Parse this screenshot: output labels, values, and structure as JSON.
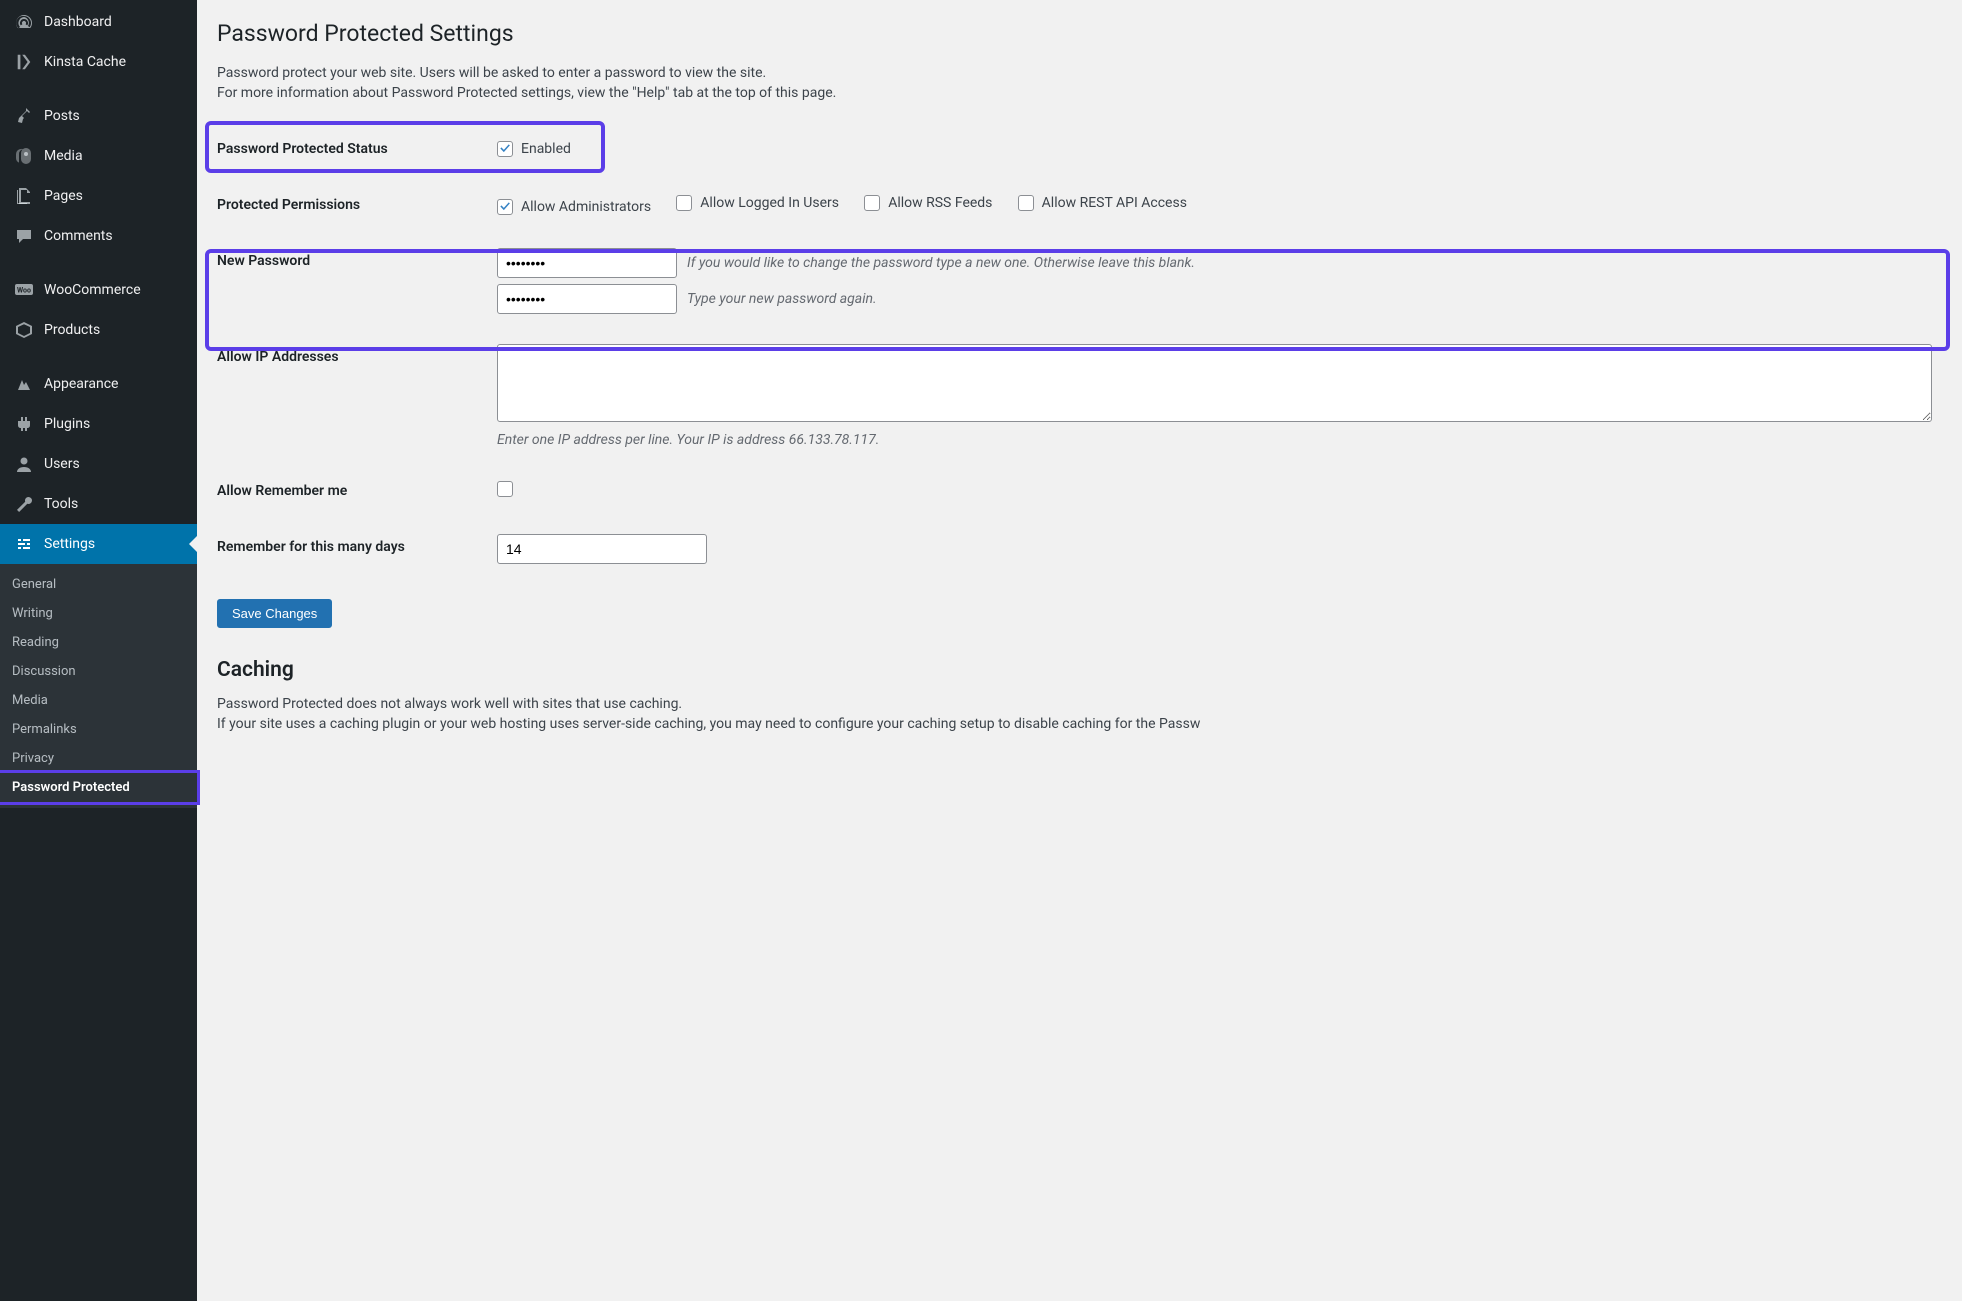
{
  "sidebar": {
    "items": [
      {
        "label": "Dashboard",
        "icon": "dashboard"
      },
      {
        "label": "Kinsta Cache",
        "icon": "kinsta"
      },
      {
        "label": "Posts",
        "icon": "pin"
      },
      {
        "label": "Media",
        "icon": "media"
      },
      {
        "label": "Pages",
        "icon": "pages"
      },
      {
        "label": "Comments",
        "icon": "comments"
      },
      {
        "label": "WooCommerce",
        "icon": "woo"
      },
      {
        "label": "Products",
        "icon": "products"
      },
      {
        "label": "Appearance",
        "icon": "appearance"
      },
      {
        "label": "Plugins",
        "icon": "plugins"
      },
      {
        "label": "Users",
        "icon": "users"
      },
      {
        "label": "Tools",
        "icon": "tools"
      },
      {
        "label": "Settings",
        "icon": "settings"
      }
    ],
    "submenu": [
      {
        "label": "General"
      },
      {
        "label": "Writing"
      },
      {
        "label": "Reading"
      },
      {
        "label": "Discussion"
      },
      {
        "label": "Media"
      },
      {
        "label": "Permalinks"
      },
      {
        "label": "Privacy"
      },
      {
        "label": "Password Protected"
      }
    ]
  },
  "page": {
    "title": "Password Protected Settings",
    "desc1": "Password protect your web site. Users will be asked to enter a password to view the site.",
    "desc2": "For more information about Password Protected settings, view the \"Help\" tab at the top of this page."
  },
  "form": {
    "status": {
      "label": "Password Protected Status",
      "enabled_label": "Enabled",
      "checked": true
    },
    "permissions": {
      "label": "Protected Permissions",
      "options": [
        {
          "label": "Allow Administrators",
          "checked": true
        },
        {
          "label": "Allow Logged In Users",
          "checked": false
        },
        {
          "label": "Allow RSS Feeds",
          "checked": false
        },
        {
          "label": "Allow REST API Access",
          "checked": false
        }
      ]
    },
    "new_password": {
      "label": "New Password",
      "value1": "••••••••",
      "value2": "••••••••",
      "hint1": "If you would like to change the password type a new one. Otherwise leave this blank.",
      "hint2": "Type your new password again."
    },
    "allow_ip": {
      "label": "Allow IP Addresses",
      "desc": "Enter one IP address per line. Your IP is address 66.133.78.117."
    },
    "allow_remember": {
      "label": "Allow Remember me"
    },
    "remember_days": {
      "label": "Remember for this many days",
      "value": "14"
    },
    "save_button": "Save Changes"
  },
  "caching": {
    "heading": "Caching",
    "p1": "Password Protected does not always work well with sites that use caching.",
    "p2": "If your site uses a caching plugin or your web hosting uses server-side caching, you may need to configure your caching setup to disable caching for the Passw"
  }
}
